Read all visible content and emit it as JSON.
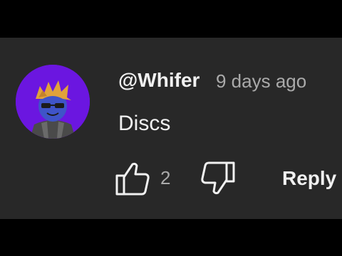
{
  "comment": {
    "author": "@Whifer",
    "timestamp": "9 days ago",
    "text": "Discs",
    "like_count": "2",
    "reply_label": "Reply"
  },
  "icons": {
    "avatar": "avatar-image",
    "like": "thumbs-up-icon",
    "dislike": "thumbs-down-icon"
  },
  "colors": {
    "panel_background": "#282828",
    "avatar_background": "#6b16e0",
    "primary_text": "#f1f1f1",
    "secondary_text": "#aaaaaa"
  }
}
